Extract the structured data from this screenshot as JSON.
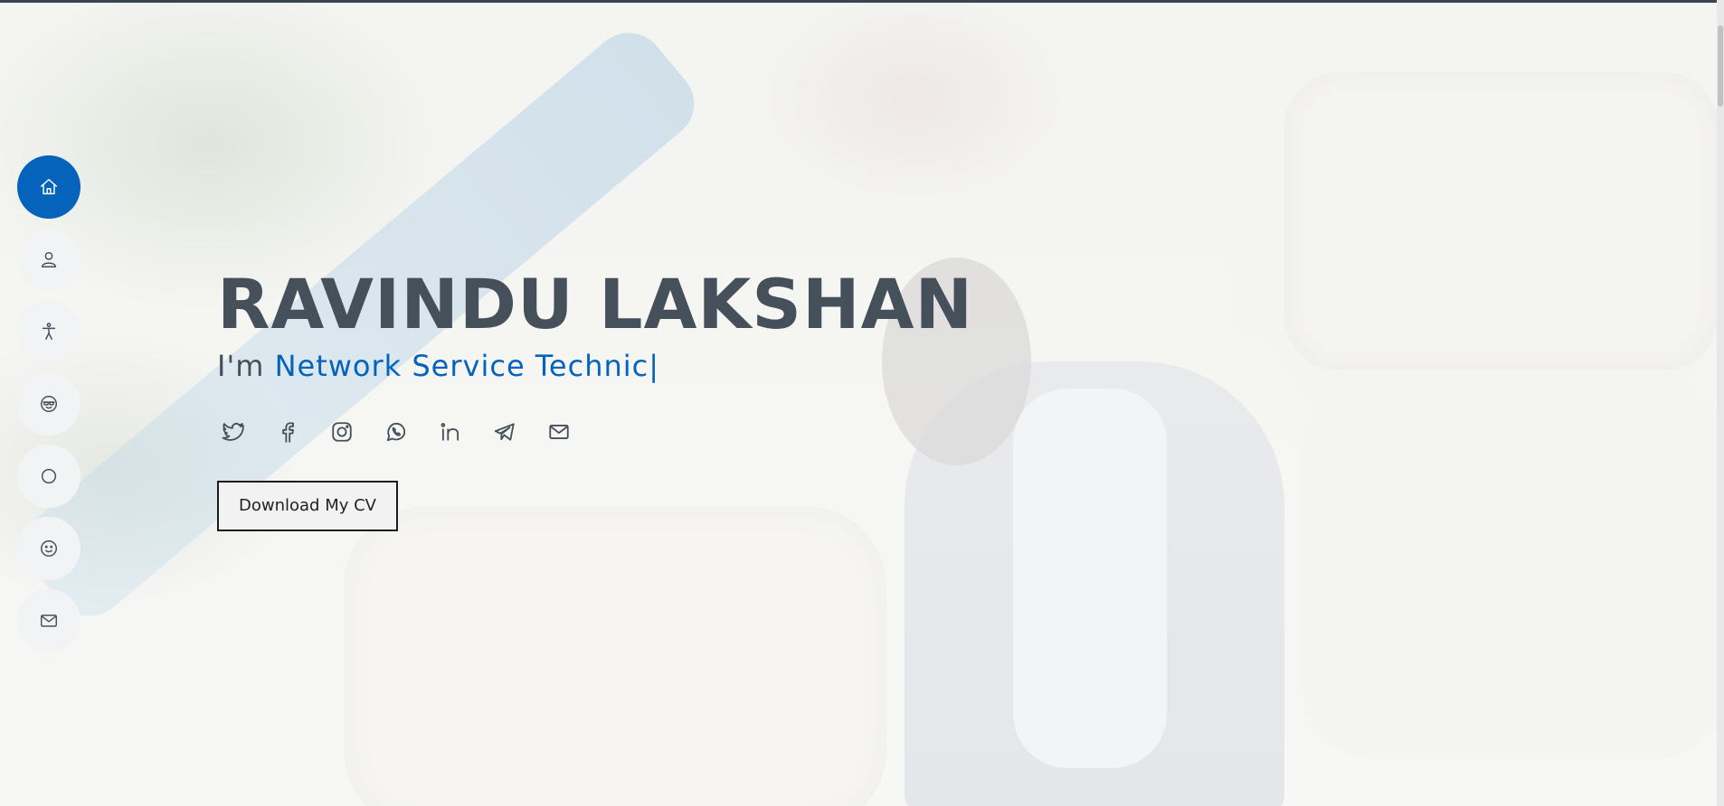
{
  "hero": {
    "name": "RAVINDU LAKSHAN",
    "prefix": "I'm",
    "typed_text": "Network Service Technic",
    "cursor": "|",
    "cv_button": "Download My CV"
  },
  "sidenav": {
    "items": [
      {
        "icon": "home-icon",
        "active": true
      },
      {
        "icon": "person-icon",
        "active": false
      },
      {
        "icon": "accessibility-icon",
        "active": false
      },
      {
        "icon": "emoji-sunglasses-icon",
        "active": false
      },
      {
        "icon": "circle-icon",
        "active": false
      },
      {
        "icon": "emoji-smile-icon",
        "active": false
      },
      {
        "icon": "envelope-icon",
        "active": false
      }
    ]
  },
  "socials": [
    "twitter-icon",
    "facebook-icon",
    "instagram-icon",
    "whatsapp-icon",
    "linkedin-icon",
    "telegram-icon",
    "envelope-icon"
  ],
  "colors": {
    "accent": "#0563bb",
    "text": "#45505b",
    "nav_bg": "#f2f3f5"
  }
}
